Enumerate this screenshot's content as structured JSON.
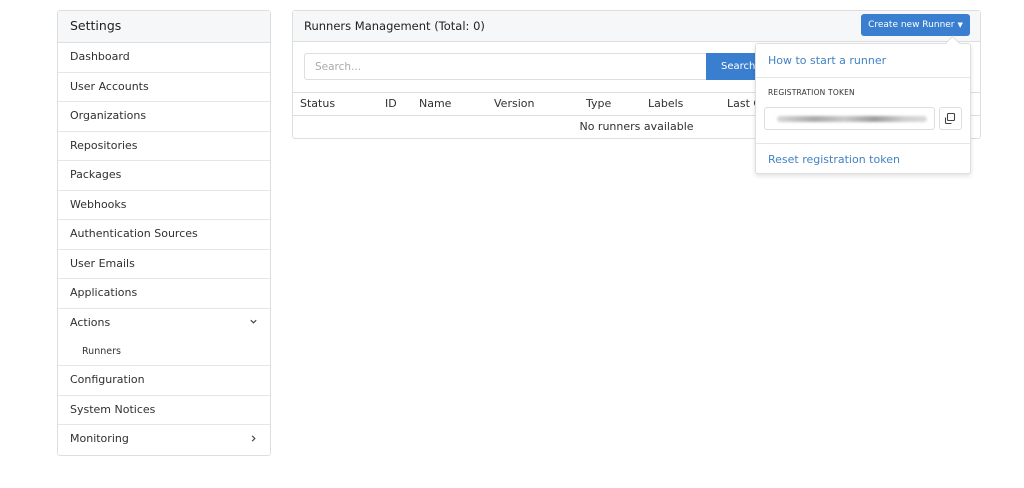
{
  "sidebar": {
    "header": "Settings",
    "items": [
      {
        "label": "Dashboard"
      },
      {
        "label": "User Accounts"
      },
      {
        "label": "Organizations"
      },
      {
        "label": "Repositories"
      },
      {
        "label": "Packages"
      },
      {
        "label": "Webhooks"
      },
      {
        "label": "Authentication Sources"
      },
      {
        "label": "User Emails"
      },
      {
        "label": "Applications"
      },
      {
        "label": "Actions",
        "expanded": true,
        "children": [
          {
            "label": "Runners"
          }
        ]
      },
      {
        "label": "Configuration"
      },
      {
        "label": "System Notices"
      },
      {
        "label": "Monitoring",
        "has_submenu": true
      }
    ]
  },
  "panel": {
    "title": "Runners Management (Total: 0)",
    "create_button": "Create new Runner",
    "search": {
      "placeholder": "Search...",
      "value": "",
      "button": "Search"
    },
    "columns": [
      "Status",
      "ID",
      "Name",
      "Version",
      "Type",
      "Labels",
      "Last C"
    ],
    "empty_text": "No runners available"
  },
  "dropdown": {
    "how_to": "How to start a runner",
    "token_label": "REGISTRATION TOKEN",
    "reset": "Reset registration token"
  },
  "icons": {
    "copy": "copy-icon",
    "chevron_down": "chevron-down-icon",
    "chevron_right": "chevron-right-icon",
    "caret_down": "caret-down-icon"
  },
  "colors": {
    "accent": "#3a7fcf",
    "link": "#4183c4",
    "border": "#dedede",
    "header_bg": "#f6f7f8"
  }
}
